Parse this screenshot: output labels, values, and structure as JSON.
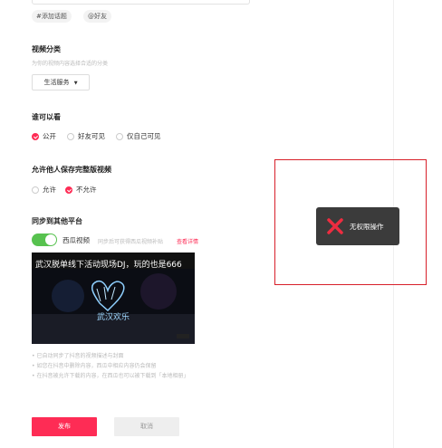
{
  "tags": {
    "add_topic": "#添加话题",
    "friends": "@好友"
  },
  "category": {
    "title": "视频分类",
    "hint": "为你的视频内容选择合适的分类",
    "selected": "生活服务",
    "arrow_icon": "caret-down-icon"
  },
  "visibility": {
    "title": "谁可以看",
    "options": [
      {
        "label": "公开",
        "checked": true
      },
      {
        "label": "好友可见",
        "checked": false
      },
      {
        "label": "仅自己可见",
        "checked": false
      }
    ]
  },
  "save_permission": {
    "title": "允许他人保存完整版视频",
    "options": [
      {
        "label": "允许",
        "checked": false
      },
      {
        "label": "不允许",
        "checked": true
      }
    ]
  },
  "sync": {
    "title": "同步到其他平台",
    "platform": "西瓜视频",
    "toggle_on": true,
    "description": "同步后可获得西瓜视频补贴",
    "detail_link": "查看详情",
    "video_title": "武汉脱单线下活动现场DJ，玩的也是666",
    "video_sign": "武汉欢乐",
    "notes": [
      "• 已自动同步了抖音的视频描述与封面",
      "• 如您在抖音中删除内容，西瓜中相应内容仍会保留",
      "• 在抖音被允许下载的内容，在西瓜也可以被下载到「本地相册」"
    ]
  },
  "actions": {
    "publish": "发布",
    "cancel": "取消"
  },
  "toast": {
    "icon": "close-x-icon",
    "message": "无权限操作",
    "icon_color": "#ee2c40"
  },
  "colors": {
    "accent": "#fe2c55",
    "toggle": "#57c24f",
    "highlight_frame": "#d8202a"
  }
}
